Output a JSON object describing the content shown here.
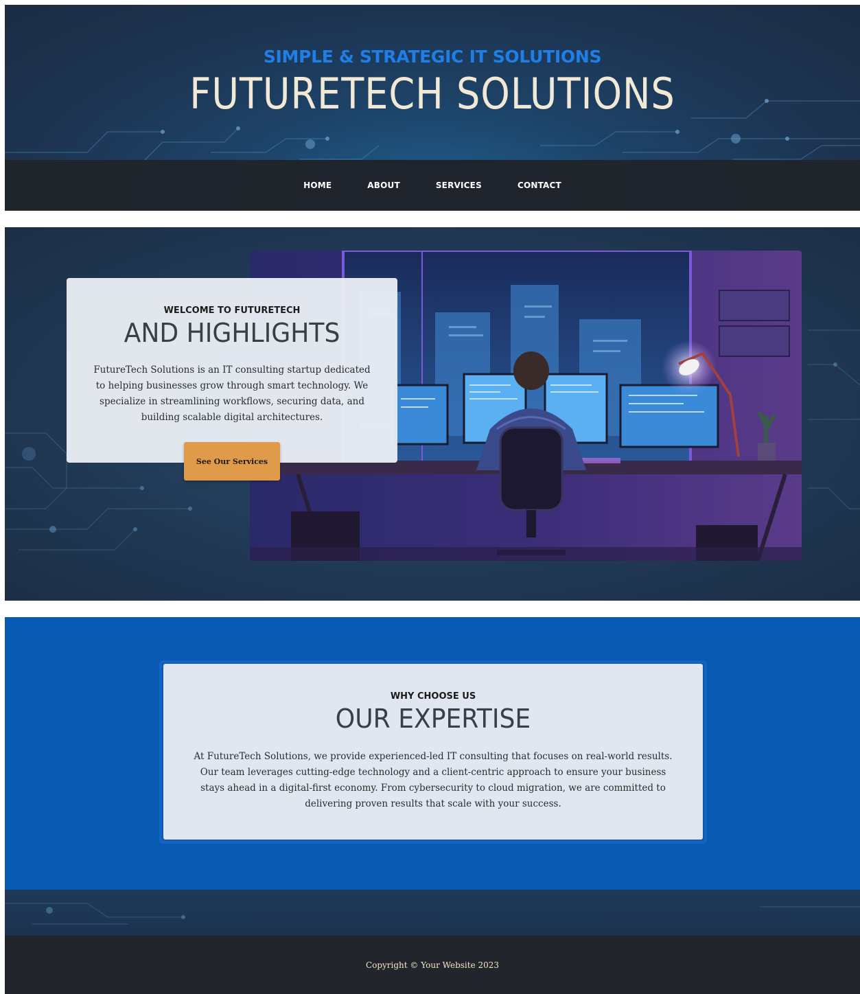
{
  "header": {
    "tagline": "SIMPLE & STRATEGIC IT SOLUTIONS",
    "title": "FUTURETECH SOLUTIONS"
  },
  "nav": {
    "items": [
      {
        "label": "HOME"
      },
      {
        "label": "ABOUT"
      },
      {
        "label": "SERVICES"
      },
      {
        "label": "CONTACT"
      }
    ]
  },
  "hero": {
    "kicker": "WELCOME TO FUTURETECH",
    "heading": "AND HIGHLIGHTS",
    "text": "FutureTech Solutions is an IT consulting startup dedicated to helping businesses grow through smart technology. We specialize in streamlining workflows, securing data, and building scalable digital architectures.",
    "button_label": "See Our Services",
    "image": "developer-at-desk-illustration"
  },
  "expertise": {
    "kicker": "WHY CHOOSE US",
    "heading": "OUR EXPERTISE",
    "text": "At FutureTech Solutions, we provide experienced-led IT consulting that focuses on real-world results. Our team leverages cutting-edge technology and a client-centric approach to ensure your business stays ahead in a digital-first economy. From cybersecurity to cloud migration, we are committed to delivering proven results that scale with your success."
  },
  "footer": {
    "copyright": "Copyright © Your Website 2023"
  },
  "colors": {
    "accent": "#1f7fe6",
    "title": "#f1e9d6",
    "button": "#e09b4a",
    "expertise_bg": "#0759b2",
    "nav_bg": "#20232a"
  }
}
